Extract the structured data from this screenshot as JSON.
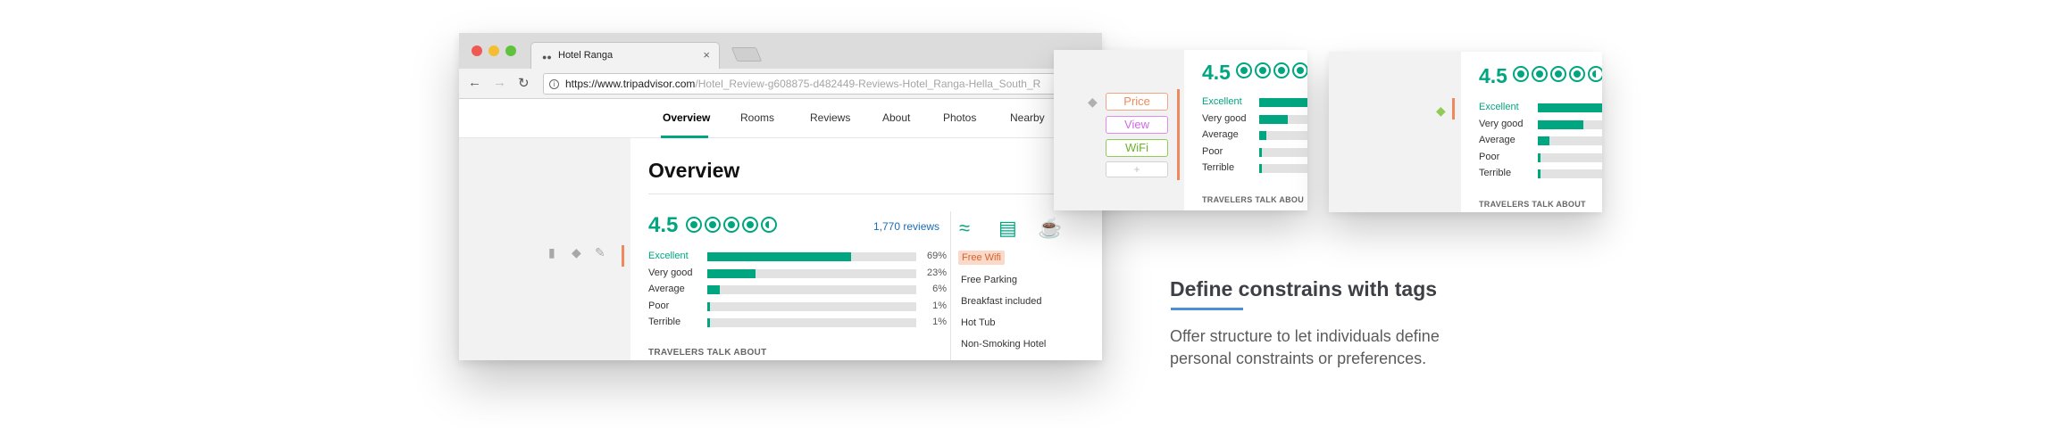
{
  "browser": {
    "tab_title": "Hotel Ranga",
    "url_main": "https://www.tripadvisor.com",
    "url_rest": "/Hotel_Review-g608875-d482449-Reviews-Hotel_Ranga-Hella_South_R",
    "nav_tabs": [
      "Overview",
      "Rooms",
      "Reviews",
      "About",
      "Photos",
      "Nearby"
    ],
    "active_tab": "Overview",
    "page_heading": "Overview",
    "score": "4.5",
    "reviews_link": "1,770 reviews",
    "ratings": [
      {
        "label": "Excellent",
        "pct_text": "69%",
        "fraction": 0.69
      },
      {
        "label": "Very good",
        "pct_text": "23%",
        "fraction": 0.23
      },
      {
        "label": "Average",
        "pct_text": "6%",
        "fraction": 0.06
      },
      {
        "label": "Poor",
        "pct_text": "1%",
        "fraction": 0.01
      },
      {
        "label": "Terrible",
        "pct_text": "1%",
        "fraction": 0.01
      }
    ],
    "travelers_label": "TRAVELERS TALK ABOUT",
    "amenities": [
      "Free Wifi",
      "Free Parking",
      "Breakfast included",
      "Hot Tub",
      "Non-Smoking Hotel"
    ],
    "highlighted_amenity": "Free Wifi"
  },
  "zoom_panel_1": {
    "tags": [
      "Price",
      "View",
      "WiFi",
      "+"
    ],
    "score": "4.5",
    "ratings": [
      {
        "label": "Excellent",
        "fraction": 0.69
      },
      {
        "label": "Very good",
        "fraction": 0.23
      },
      {
        "label": "Average",
        "fraction": 0.06
      },
      {
        "label": "Poor",
        "fraction": 0.01
      },
      {
        "label": "Terrible",
        "fraction": 0.01
      }
    ],
    "travelers_label": "TRAVELERS TALK ABOU"
  },
  "zoom_panel_2": {
    "score": "4.5",
    "ratings": [
      {
        "label": "Excellent",
        "fraction": 0.69
      },
      {
        "label": "Very good",
        "fraction": 0.23
      },
      {
        "label": "Average",
        "fraction": 0.06
      },
      {
        "label": "Poor",
        "fraction": 0.01
      },
      {
        "label": "Terrible",
        "fraction": 0.01
      }
    ],
    "travelers_label": "TRAVELERS TALK ABOUT"
  },
  "caption": {
    "heading": "Define constrains with tags",
    "body": "Offer structure to let individuals define personal constraints or preferences."
  },
  "colors": {
    "accent_green": "#00a680",
    "tag_orange": "#f08a5d",
    "tag_purple": "#cf6ae5",
    "tag_green": "#6bb12f",
    "underline_blue": "#4a90d9"
  },
  "icons": [
    "tab-favicon-icon",
    "back-arrow-icon",
    "forward-arrow-icon",
    "reload-icon",
    "info-icon",
    "comment-icon",
    "tag-icon",
    "pencil-icon",
    "wifi-icon",
    "car-icon",
    "coffee-cup-icon"
  ]
}
